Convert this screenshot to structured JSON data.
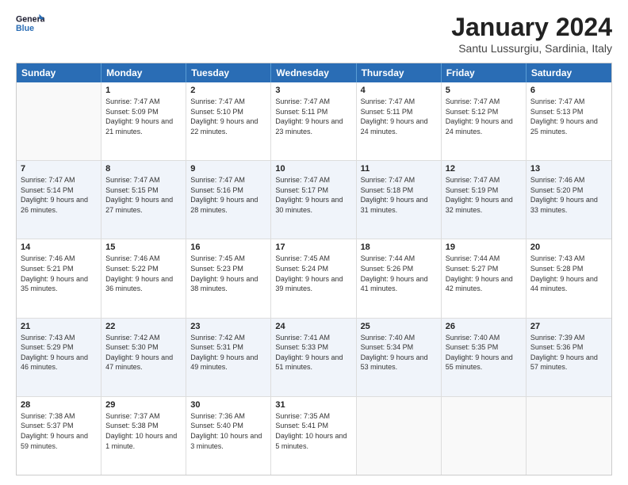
{
  "logo": {
    "line1": "General",
    "line2": "Blue"
  },
  "title": "January 2024",
  "subtitle": "Santu Lussurgiu, Sardinia, Italy",
  "headers": [
    "Sunday",
    "Monday",
    "Tuesday",
    "Wednesday",
    "Thursday",
    "Friday",
    "Saturday"
  ],
  "weeks": [
    [
      {
        "day": "",
        "sunrise": "",
        "sunset": "",
        "daylight": ""
      },
      {
        "day": "1",
        "sunrise": "Sunrise: 7:47 AM",
        "sunset": "Sunset: 5:09 PM",
        "daylight": "Daylight: 9 hours and 21 minutes."
      },
      {
        "day": "2",
        "sunrise": "Sunrise: 7:47 AM",
        "sunset": "Sunset: 5:10 PM",
        "daylight": "Daylight: 9 hours and 22 minutes."
      },
      {
        "day": "3",
        "sunrise": "Sunrise: 7:47 AM",
        "sunset": "Sunset: 5:11 PM",
        "daylight": "Daylight: 9 hours and 23 minutes."
      },
      {
        "day": "4",
        "sunrise": "Sunrise: 7:47 AM",
        "sunset": "Sunset: 5:11 PM",
        "daylight": "Daylight: 9 hours and 24 minutes."
      },
      {
        "day": "5",
        "sunrise": "Sunrise: 7:47 AM",
        "sunset": "Sunset: 5:12 PM",
        "daylight": "Daylight: 9 hours and 24 minutes."
      },
      {
        "day": "6",
        "sunrise": "Sunrise: 7:47 AM",
        "sunset": "Sunset: 5:13 PM",
        "daylight": "Daylight: 9 hours and 25 minutes."
      }
    ],
    [
      {
        "day": "7",
        "sunrise": "Sunrise: 7:47 AM",
        "sunset": "Sunset: 5:14 PM",
        "daylight": "Daylight: 9 hours and 26 minutes."
      },
      {
        "day": "8",
        "sunrise": "Sunrise: 7:47 AM",
        "sunset": "Sunset: 5:15 PM",
        "daylight": "Daylight: 9 hours and 27 minutes."
      },
      {
        "day": "9",
        "sunrise": "Sunrise: 7:47 AM",
        "sunset": "Sunset: 5:16 PM",
        "daylight": "Daylight: 9 hours and 28 minutes."
      },
      {
        "day": "10",
        "sunrise": "Sunrise: 7:47 AM",
        "sunset": "Sunset: 5:17 PM",
        "daylight": "Daylight: 9 hours and 30 minutes."
      },
      {
        "day": "11",
        "sunrise": "Sunrise: 7:47 AM",
        "sunset": "Sunset: 5:18 PM",
        "daylight": "Daylight: 9 hours and 31 minutes."
      },
      {
        "day": "12",
        "sunrise": "Sunrise: 7:47 AM",
        "sunset": "Sunset: 5:19 PM",
        "daylight": "Daylight: 9 hours and 32 minutes."
      },
      {
        "day": "13",
        "sunrise": "Sunrise: 7:46 AM",
        "sunset": "Sunset: 5:20 PM",
        "daylight": "Daylight: 9 hours and 33 minutes."
      }
    ],
    [
      {
        "day": "14",
        "sunrise": "Sunrise: 7:46 AM",
        "sunset": "Sunset: 5:21 PM",
        "daylight": "Daylight: 9 hours and 35 minutes."
      },
      {
        "day": "15",
        "sunrise": "Sunrise: 7:46 AM",
        "sunset": "Sunset: 5:22 PM",
        "daylight": "Daylight: 9 hours and 36 minutes."
      },
      {
        "day": "16",
        "sunrise": "Sunrise: 7:45 AM",
        "sunset": "Sunset: 5:23 PM",
        "daylight": "Daylight: 9 hours and 38 minutes."
      },
      {
        "day": "17",
        "sunrise": "Sunrise: 7:45 AM",
        "sunset": "Sunset: 5:24 PM",
        "daylight": "Daylight: 9 hours and 39 minutes."
      },
      {
        "day": "18",
        "sunrise": "Sunrise: 7:44 AM",
        "sunset": "Sunset: 5:26 PM",
        "daylight": "Daylight: 9 hours and 41 minutes."
      },
      {
        "day": "19",
        "sunrise": "Sunrise: 7:44 AM",
        "sunset": "Sunset: 5:27 PM",
        "daylight": "Daylight: 9 hours and 42 minutes."
      },
      {
        "day": "20",
        "sunrise": "Sunrise: 7:43 AM",
        "sunset": "Sunset: 5:28 PM",
        "daylight": "Daylight: 9 hours and 44 minutes."
      }
    ],
    [
      {
        "day": "21",
        "sunrise": "Sunrise: 7:43 AM",
        "sunset": "Sunset: 5:29 PM",
        "daylight": "Daylight: 9 hours and 46 minutes."
      },
      {
        "day": "22",
        "sunrise": "Sunrise: 7:42 AM",
        "sunset": "Sunset: 5:30 PM",
        "daylight": "Daylight: 9 hours and 47 minutes."
      },
      {
        "day": "23",
        "sunrise": "Sunrise: 7:42 AM",
        "sunset": "Sunset: 5:31 PM",
        "daylight": "Daylight: 9 hours and 49 minutes."
      },
      {
        "day": "24",
        "sunrise": "Sunrise: 7:41 AM",
        "sunset": "Sunset: 5:33 PM",
        "daylight": "Daylight: 9 hours and 51 minutes."
      },
      {
        "day": "25",
        "sunrise": "Sunrise: 7:40 AM",
        "sunset": "Sunset: 5:34 PM",
        "daylight": "Daylight: 9 hours and 53 minutes."
      },
      {
        "day": "26",
        "sunrise": "Sunrise: 7:40 AM",
        "sunset": "Sunset: 5:35 PM",
        "daylight": "Daylight: 9 hours and 55 minutes."
      },
      {
        "day": "27",
        "sunrise": "Sunrise: 7:39 AM",
        "sunset": "Sunset: 5:36 PM",
        "daylight": "Daylight: 9 hours and 57 minutes."
      }
    ],
    [
      {
        "day": "28",
        "sunrise": "Sunrise: 7:38 AM",
        "sunset": "Sunset: 5:37 PM",
        "daylight": "Daylight: 9 hours and 59 minutes."
      },
      {
        "day": "29",
        "sunrise": "Sunrise: 7:37 AM",
        "sunset": "Sunset: 5:38 PM",
        "daylight": "Daylight: 10 hours and 1 minute."
      },
      {
        "day": "30",
        "sunrise": "Sunrise: 7:36 AM",
        "sunset": "Sunset: 5:40 PM",
        "daylight": "Daylight: 10 hours and 3 minutes."
      },
      {
        "day": "31",
        "sunrise": "Sunrise: 7:35 AM",
        "sunset": "Sunset: 5:41 PM",
        "daylight": "Daylight: 10 hours and 5 minutes."
      },
      {
        "day": "",
        "sunrise": "",
        "sunset": "",
        "daylight": ""
      },
      {
        "day": "",
        "sunrise": "",
        "sunset": "",
        "daylight": ""
      },
      {
        "day": "",
        "sunrise": "",
        "sunset": "",
        "daylight": ""
      }
    ]
  ]
}
